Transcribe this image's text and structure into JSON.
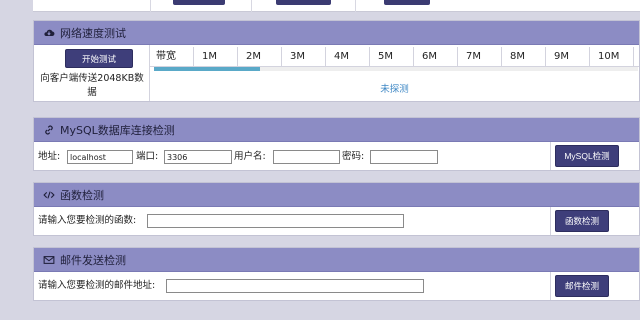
{
  "speed_test": {
    "title": "网络速度测试",
    "icon": "cloud-download-icon",
    "start_button": "开始测试",
    "description": "向客户端传送2048KB数据",
    "scale": [
      "带宽",
      "1M",
      "2M",
      "3M",
      "4M",
      "5M",
      "6M",
      "7M",
      "8M",
      "9M",
      "10M"
    ],
    "progress_fraction": 0.22,
    "status": "未探测"
  },
  "mysql": {
    "title": "MySQL数据库连接检测",
    "icon": "link-icon",
    "address_label": "地址:",
    "address_value": "localhost",
    "port_label": "端口:",
    "port_value": "3306",
    "username_label": "用户名:",
    "username_value": "",
    "password_label": "密码:",
    "password_value": "",
    "button": "MySQL检测"
  },
  "function_check": {
    "title": "函数检测",
    "icon": "code-icon",
    "label": "请输入您要检测的函数:",
    "value": "",
    "button": "函数检测"
  },
  "mail_check": {
    "title": "邮件发送检测",
    "icon": "envelope-icon",
    "label": "请输入您要检测的邮件地址:",
    "value": "",
    "button": "邮件检测"
  },
  "colors": {
    "header_bg": "#8c8cc4",
    "button_bg": "#3e3e7a",
    "progress": "#5aa9c8",
    "status_text": "#3f88c5"
  }
}
